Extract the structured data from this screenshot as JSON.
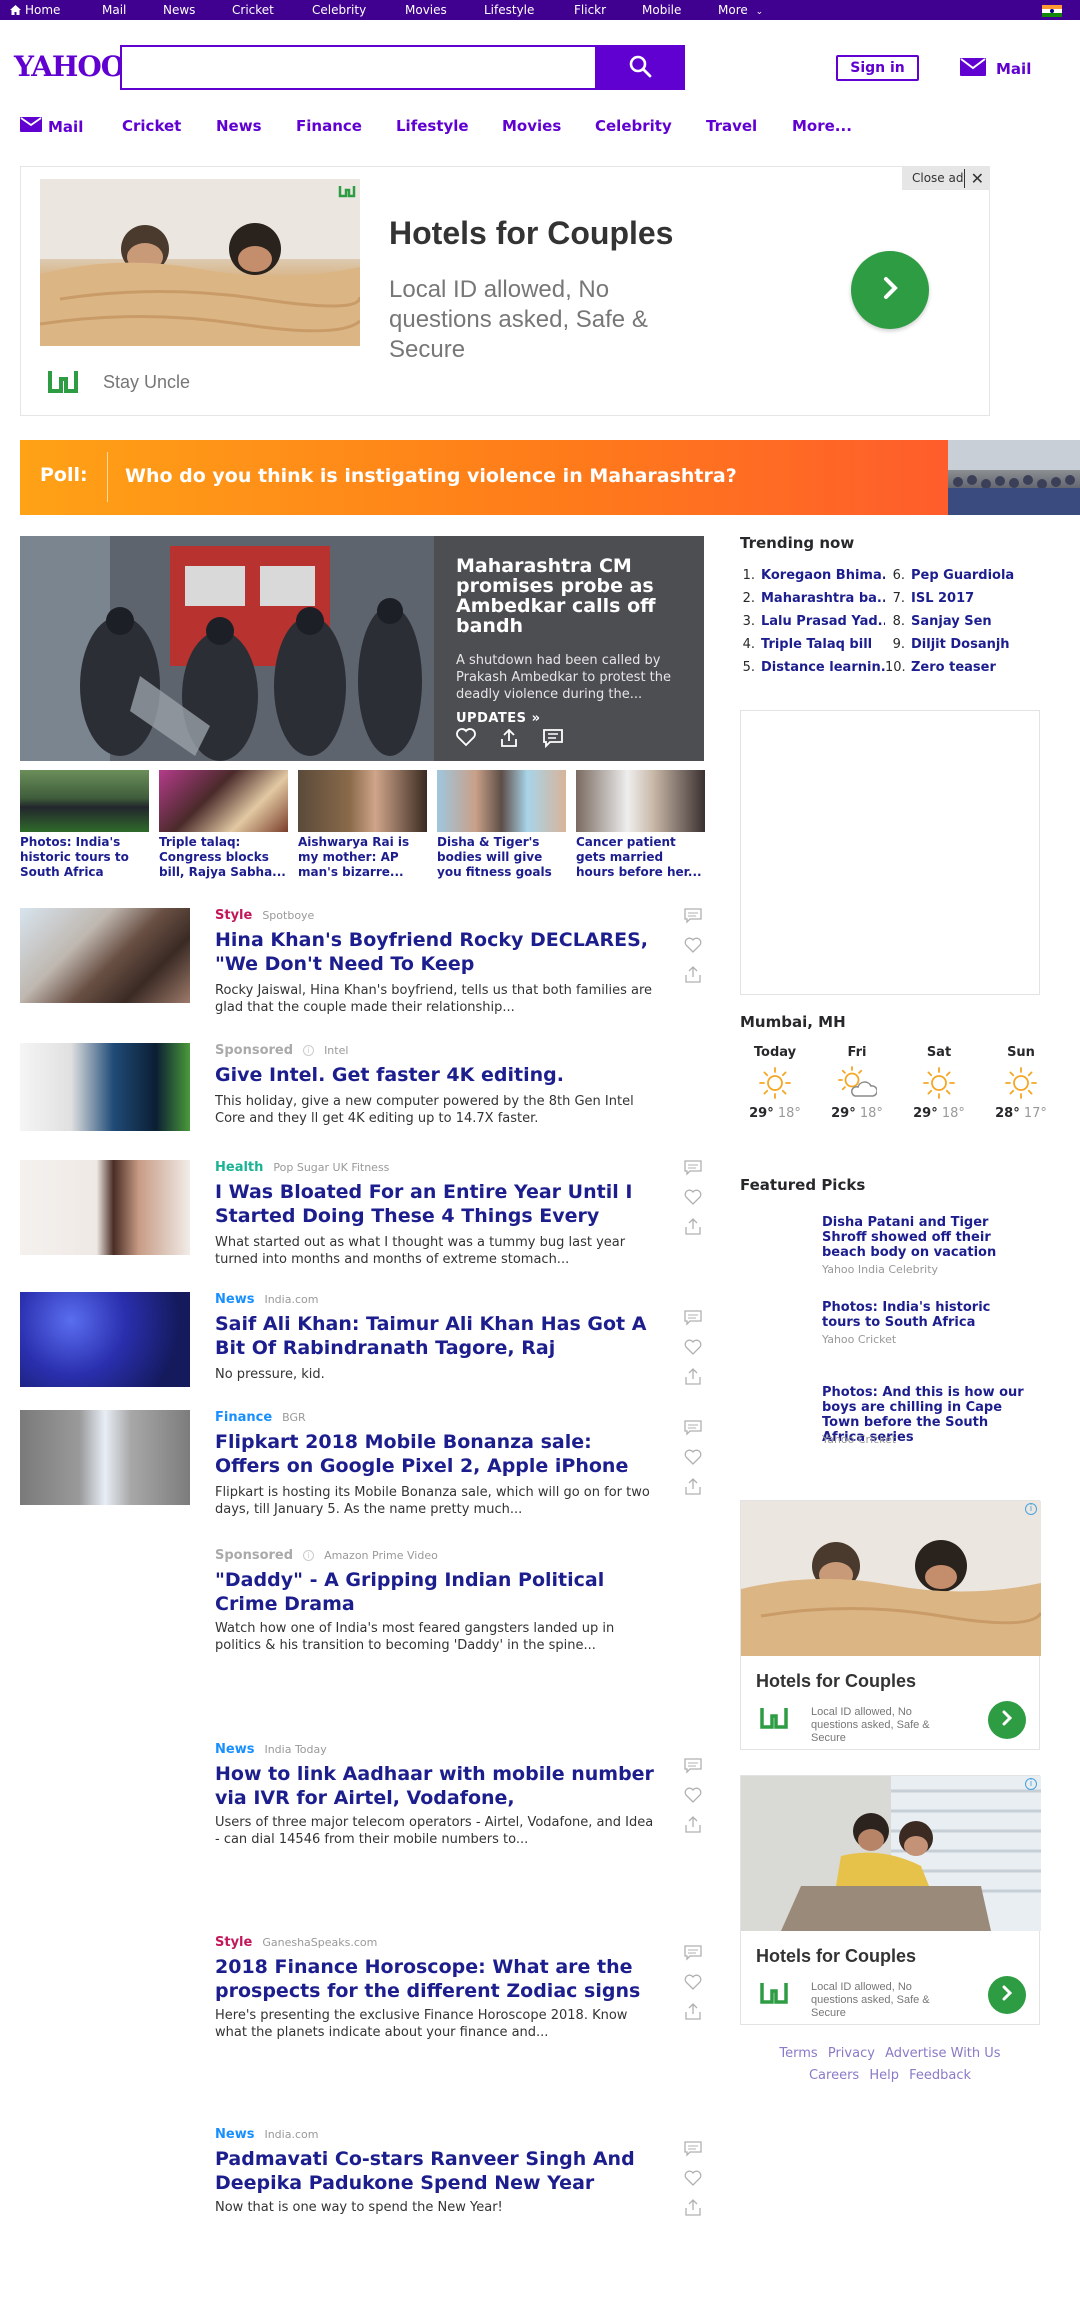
{
  "topbar": {
    "items": [
      "Home",
      "Mail",
      "News",
      "Cricket",
      "Celebrity",
      "Movies",
      "Lifestyle",
      "Flickr",
      "Mobile",
      "More"
    ]
  },
  "header": {
    "logo": "YAHOO!",
    "search_value": "",
    "signin": "Sign in",
    "mail": "Mail"
  },
  "nav": {
    "items": [
      "Mail",
      "Cricket",
      "News",
      "Finance",
      "Lifestyle",
      "Movies",
      "Celebrity",
      "Travel",
      "More..."
    ]
  },
  "ad": {
    "close": "Close ad",
    "title": "Hotels for Couples",
    "desc": "Local ID allowed, No questions asked, Safe & Secure",
    "brand": "Stay Uncle"
  },
  "poll": {
    "label": "Poll:",
    "question": "Who do you think is instigating violence in Maharashtra?"
  },
  "hero": {
    "title": "Maharashtra CM promises probe as Ambedkar calls off bandh",
    "desc": "A shutdown had been called by Prakash Ambedkar to protest the deadly violence during the...",
    "updates": "UPDATES »"
  },
  "thumbs": [
    {
      "title": "Photos: India's historic tours to South Africa"
    },
    {
      "title": "Triple talaq: Congress blocks bill, Rajya Sabha..."
    },
    {
      "title": "Aishwarya Rai is my mother: AP man's bizarre..."
    },
    {
      "title": "Disha & Tiger's bodies will give you fitness goals"
    },
    {
      "title": "Cancer patient gets married hours before her..."
    }
  ],
  "stream": [
    {
      "cat": "Style",
      "prov": "Spotboye",
      "title": "Hina Khan's Boyfriend Rocky DECLARES, \"We Don't Need To Keep",
      "summary": "Rocky Jaiswal, Hina Khan's boyfriend, tells us that both families are glad that the couple made their relationship..."
    },
    {
      "cat": "Sponsored",
      "prov": "Intel",
      "title": "Give Intel. Get faster 4K editing.",
      "summary": "This holiday, give a new computer powered by the 8th Gen Intel Core and they ll get 4K editing up to 14.7X faster."
    },
    {
      "cat": "Health",
      "prov": "Pop Sugar UK Fitness",
      "title": "I Was Bloated For an Entire Year Until I Started Doing These 4 Things Every",
      "summary": "What started out as what I thought was a tummy bug last year turned into months and months of extreme stomach..."
    },
    {
      "cat": "News",
      "prov": "India.com",
      "title": "Saif Ali Khan: Taimur Ali Khan Has Got A Bit Of Rabindranath Tagore, Raj",
      "summary": "No pressure, kid."
    },
    {
      "cat": "Finance",
      "prov": "BGR",
      "title": "Flipkart 2018 Mobile Bonanza sale: Offers on Google Pixel 2, Apple iPhone",
      "summary": "Flipkart is hosting its Mobile Bonanza sale, which will go on for two days, till January 5. As the name pretty much..."
    },
    {
      "cat": "Sponsored",
      "prov": "Amazon Prime Video",
      "title": "\"Daddy\" - A Gripping Indian Political Crime Drama",
      "summary": "Watch how one of India's most feared gangsters landed up in politics & his transition to becoming 'Daddy' in the spine..."
    },
    {
      "cat": "News",
      "prov": "India Today",
      "title": "How to link Aadhaar with mobile number via IVR for Airtel, Vodafone,",
      "summary": "Users of three major telecom operators - Airtel, Vodafone, and Idea - can dial 14546 from their mobile numbers to..."
    },
    {
      "cat": "Style",
      "prov": "GaneshaSpeaks.com",
      "title": "2018 Finance Horoscope: What are the prospects for the different Zodiac signs",
      "summary": "Here's presenting the exclusive Finance Horoscope 2018. Know what the planets indicate about your finance and..."
    },
    {
      "cat": "News",
      "prov": "India.com",
      "title": "Padmavati Co-stars Ranveer Singh And Deepika Padukone Spend New Year",
      "summary": "Now that is one way to spend the New Year!"
    }
  ],
  "trending": {
    "heading": "Trending now",
    "items": [
      {
        "n": "1.",
        "t": "Koregaon Bhima..."
      },
      {
        "n": "2.",
        "t": "Maharashtra ba..."
      },
      {
        "n": "3.",
        "t": "Lalu Prasad Yad..."
      },
      {
        "n": "4.",
        "t": "Triple Talaq bill"
      },
      {
        "n": "5.",
        "t": "Distance learnin..."
      },
      {
        "n": "6.",
        "t": "Pep Guardiola"
      },
      {
        "n": "7.",
        "t": "ISL 2017"
      },
      {
        "n": "8.",
        "t": "Sanjay Sen"
      },
      {
        "n": "9.",
        "t": "Diljit Dosanjh"
      },
      {
        "n": "10.",
        "t": "Zero teaser"
      }
    ]
  },
  "weather": {
    "location": "Mumbai, MH",
    "days": [
      {
        "d": "Today",
        "hi": "29°",
        "lo": "18°",
        "icon": "sun-icon"
      },
      {
        "d": "Fri",
        "hi": "29°",
        "lo": "18°",
        "icon": "partly-cloudy-icon"
      },
      {
        "d": "Sat",
        "hi": "29°",
        "lo": "18°",
        "icon": "sun-icon"
      },
      {
        "d": "Sun",
        "hi": "28°",
        "lo": "17°",
        "icon": "sun-icon"
      }
    ]
  },
  "featured": {
    "heading": "Featured Picks",
    "items": [
      {
        "t": "Disha Patani and Tiger Shroff showed off their beach body on vacation",
        "s": "Yahoo India Celebrity"
      },
      {
        "t": "Photos: India's historic tours to South Africa",
        "s": "Yahoo Cricket"
      },
      {
        "t": "Photos: And this is how our boys are chilling in Cape Town before the South Africa series",
        "s": "Yahoo Cricket"
      }
    ]
  },
  "side_ads": [
    {
      "title": "Hotels for Couples",
      "desc": "Local ID allowed, No questions asked, Safe & Secure"
    },
    {
      "title": "Hotels for Couples",
      "desc": "Local ID allowed, No questions asked, Safe & Secure"
    }
  ],
  "footer": {
    "links": [
      "Terms",
      "Privacy",
      "Advertise With Us",
      "Careers",
      "Help",
      "Feedback"
    ]
  },
  "colors": {
    "brand": "#6001d2",
    "headline": "#1d1e8e",
    "style": "#c2185b",
    "health": "#1ab394",
    "news": "#188fff",
    "finance": "#188fff",
    "sponsored": "#aaaaaa",
    "ad_green": "#2e9c43"
  }
}
